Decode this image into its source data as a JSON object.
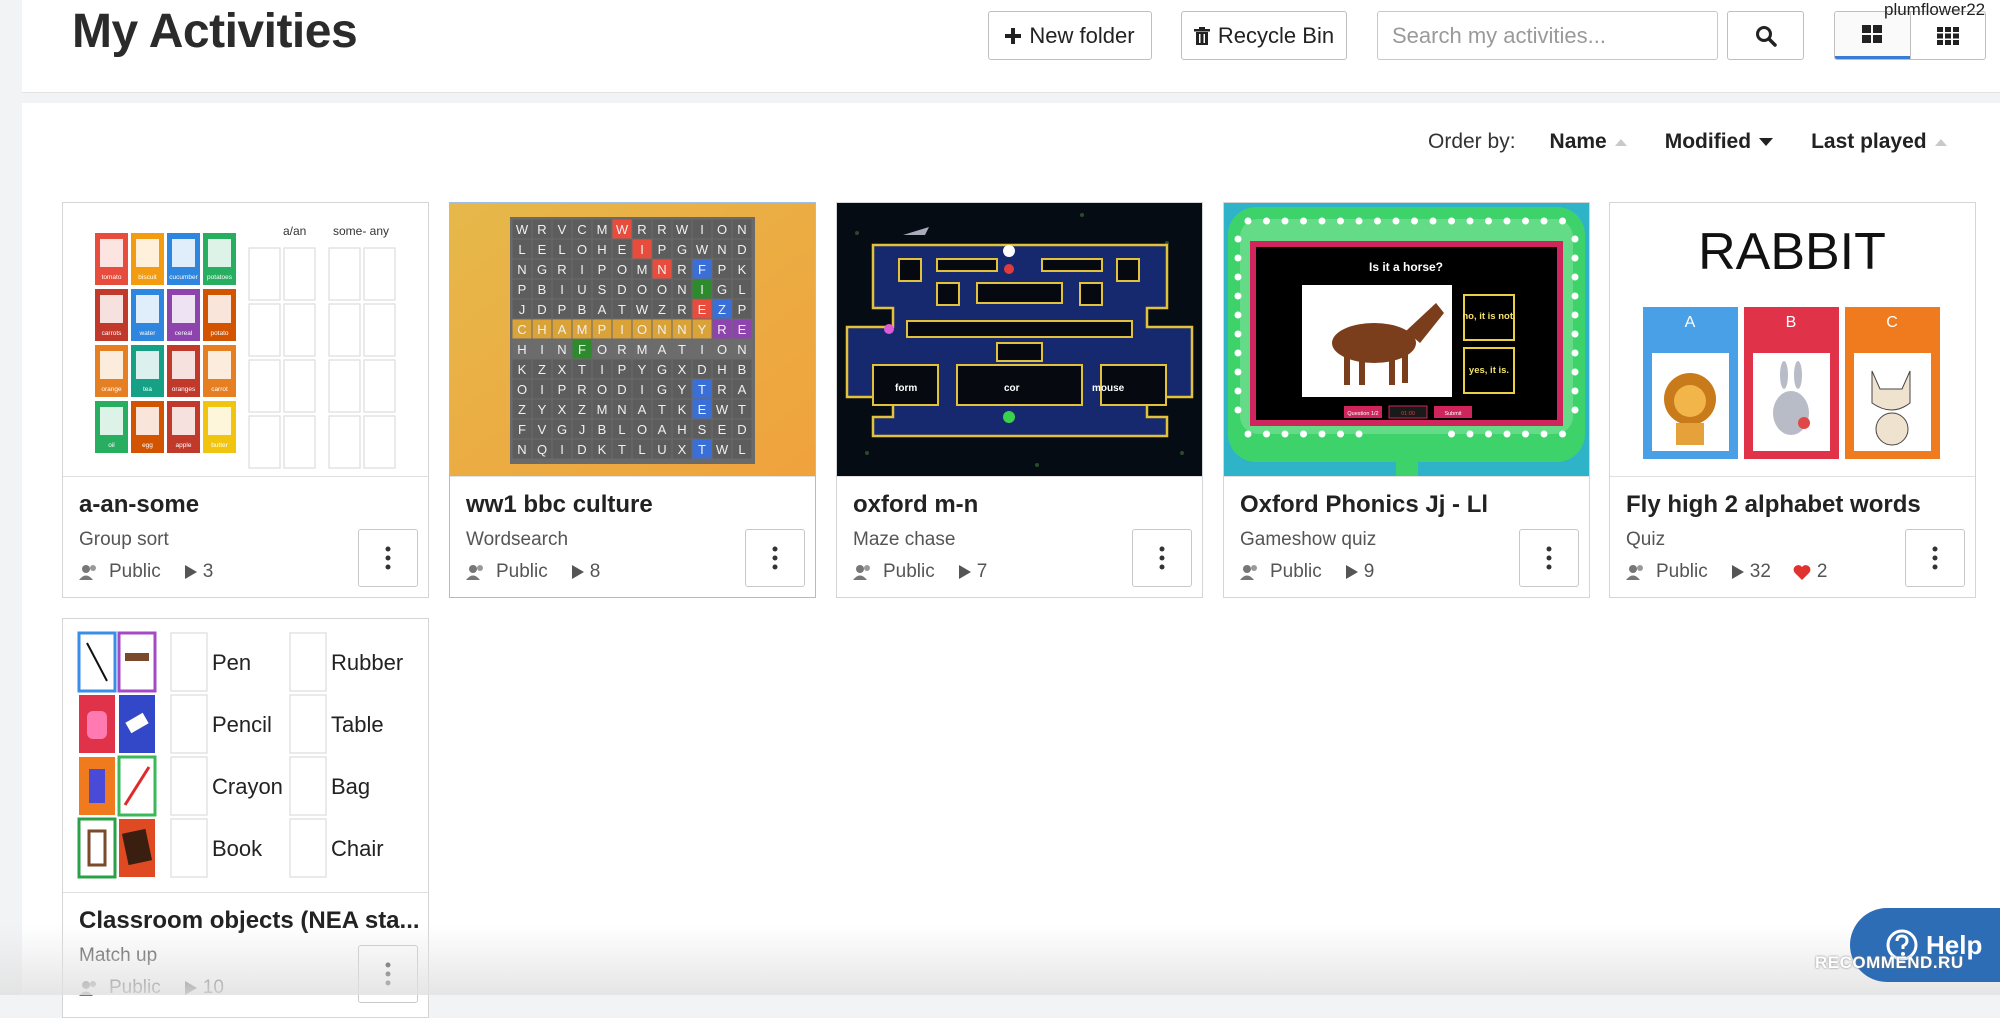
{
  "header": {
    "title": "My Activities",
    "new_folder_label": "New folder",
    "recycle_bin_label": "Recycle Bin",
    "search_placeholder": "Search my activities...",
    "username": "plumflower22"
  },
  "order_bar": {
    "label": "Order by:",
    "options": [
      "Name",
      "Modified",
      "Last played"
    ],
    "active": "Modified"
  },
  "activities": [
    {
      "title": "a-an-some",
      "type": "Group sort",
      "visibility": "Public",
      "plays": "3",
      "thumb": {
        "headers": [
          "a/an",
          "some- any"
        ],
        "tiles": [
          "tomato",
          "biscuit",
          "cucumber",
          "potatoes",
          "carrots",
          "water",
          "cereal",
          "potato",
          "orange",
          "tea",
          "oranges",
          "carrot",
          "oil",
          "egg",
          "apple",
          "butter"
        ]
      }
    },
    {
      "title": "ww1 bbc culture",
      "type": "Wordsearch",
      "visibility": "Public",
      "plays": "8",
      "thumb": {
        "rows": [
          "WRVCMWRRWION",
          "LELOHEIPGWND",
          "NGRIPOMNRFPK",
          "PBIUSDOONIGL",
          "JDPBATWZREZP",
          "CHAMPIONNYRE",
          "HINFORMATION",
          "KZXTIPYGXDHB",
          "OIPRODIGYTRA",
          "ZYXZMNATKEWT",
          "FVGJBLOAHSED",
          "NQIDKTLUXTWL"
        ]
      }
    },
    {
      "title": "oxford m-n",
      "type": "Maze chase",
      "visibility": "Public",
      "plays": "7",
      "thumb": {
        "labels": [
          "form",
          "cor",
          "mouse"
        ]
      }
    },
    {
      "title": "Oxford Phonics Jj - Ll",
      "type": "Gameshow quiz",
      "visibility": "Public",
      "plays": "9",
      "thumb": {
        "question": "Is it a horse?",
        "answers": [
          "no, it is not.",
          "yes, it is."
        ],
        "footer": [
          "Question 1/2",
          "01:00",
          "Submit"
        ]
      }
    },
    {
      "title": "Fly high 2 alphabet words",
      "type": "Quiz",
      "visibility": "Public",
      "plays": "32",
      "likes": "2",
      "thumb": {
        "word": "RABBIT",
        "options": [
          "A",
          "B",
          "C"
        ]
      }
    },
    {
      "title": "Classroom objects (NEA sta...",
      "type": "Match up",
      "visibility": "Public",
      "plays": "10",
      "thumb": {
        "words_left": [
          "Pen",
          "Pencil",
          "Crayon",
          "Book"
        ],
        "words_right": [
          "Rubber",
          "Table",
          "Bag",
          "Chair"
        ]
      }
    }
  ],
  "help_label": "Help",
  "watermark": "RECOMMEND.RU",
  "colors": {
    "accent": "#3a7bd5",
    "help": "#2d6db5",
    "heart": "#e0332f"
  }
}
